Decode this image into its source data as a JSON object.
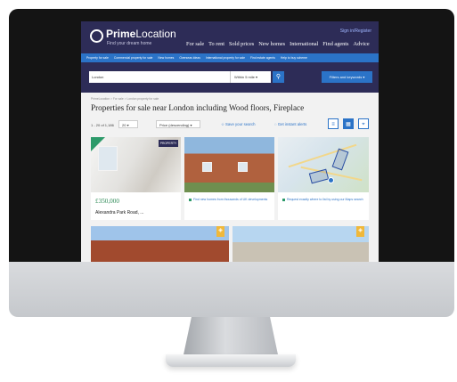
{
  "brand": {
    "logo_bold": "Prime",
    "logo_light": "Location",
    "tagline": "Find your dream home",
    "accent": "#2b73c7",
    "navy": "#2d2c57",
    "price_green": "#2d8a56"
  },
  "header": {
    "signin_label": "Sign in/Register",
    "nav": [
      "For sale",
      "To rent",
      "Sold prices",
      "New homes",
      "International",
      "Find agents",
      "Advice"
    ],
    "subnav": [
      "Property for sale",
      "Commercial property for sale",
      "New homes",
      "Overseas ideas",
      "International property for sale",
      "Find estate agents",
      "Help to buy scheme"
    ]
  },
  "search": {
    "location_value": "London",
    "radius_value": "Within 5 mile",
    "search_icon": "search-icon",
    "filters_label": "Filters and keywords"
  },
  "results": {
    "breadcrumb": "PrimeLocation > For sale > London property for sale",
    "title": "Properties for sale near London including Wood floors, Fireplace",
    "count_label": "1 - 20 of 1,186",
    "per_page": "20",
    "sort_label": "Price (descending)",
    "save_search": "Save your search",
    "instant_alerts": "Get instant alerts"
  },
  "cards": [
    {
      "price": "£350,000",
      "address": "Alexandra Park Road, ...",
      "agent_logo": "PROPERTY"
    },
    {
      "promo": "Find new homes from thousands of UK developments"
    },
    {
      "promo": "Request exactly where to list by using our Maps search"
    }
  ]
}
